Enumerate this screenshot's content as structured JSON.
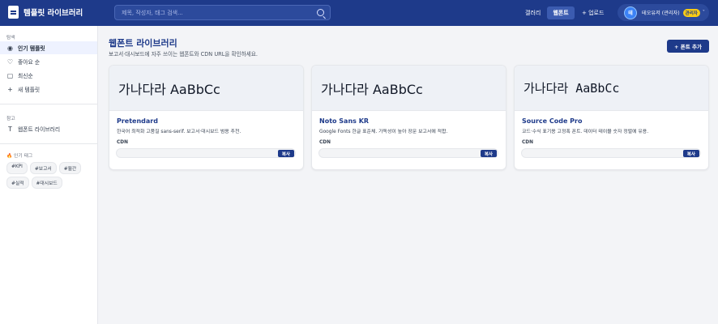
{
  "app": {
    "title": "템플릿 라이브러리",
    "logo_icon": "document-icon"
  },
  "search": {
    "placeholder": "제목, 작성자, 태그 검색..."
  },
  "nav": {
    "gallery": "갤러리",
    "font": "웹폰트",
    "upload": "+ 업로드"
  },
  "user": {
    "initial": "테",
    "name": "테오유저 (관리자)",
    "badge": "관리자",
    "caret": "˅"
  },
  "sidebar": {
    "explore_label": "탐색",
    "items": [
      {
        "label": "인기 템플릿",
        "icon": "eye-icon",
        "glyph": "◉"
      },
      {
        "label": "좋아요 순",
        "icon": "heart-icon",
        "glyph": "♡"
      },
      {
        "label": "최신순",
        "icon": "calendar-icon",
        "glyph": "▢"
      },
      {
        "label": "새 템플릿",
        "icon": "plus-icon",
        "glyph": "+"
      }
    ],
    "ref_label": "참고",
    "ref_item": {
      "label": "웹폰트 라이브러리",
      "icon": "type-icon",
      "glyph": "T"
    },
    "tags_label": "🔥 인기 태그",
    "tags": [
      "#KPI",
      "#보고서",
      "#월간",
      "#실적",
      "#대시보드"
    ]
  },
  "main": {
    "title": "웹폰트 라이브러리",
    "subtitle": "보고서·대시보드에 자주 쓰이는 웹폰트와 CDN URL을 확인하세요.",
    "add_button": "+ 폰트 추가"
  },
  "cards": [
    {
      "preview": "가나다라 AaBbCc",
      "name": "Pretendard",
      "desc": "한국어 최적화 고품질 sans-serif. 보고서·대시보드 범용 추천.",
      "cdn_label": "CDN",
      "copy": "복사"
    },
    {
      "preview": "가나다라 AaBbCc",
      "name": "Noto Sans KR",
      "desc": "Google Fonts 한글 표준체. 가독성이 높아 장문 보고서에 적합.",
      "cdn_label": "CDN",
      "copy": "복사"
    },
    {
      "preview": "가나다라 AaBbCc",
      "name": "Source Code Pro",
      "desc": "코드·수식 표기용 고정폭 폰트. 데이터 테이블 숫자 정렬에 유용.",
      "cdn_label": "CDN",
      "copy": "복사"
    }
  ]
}
